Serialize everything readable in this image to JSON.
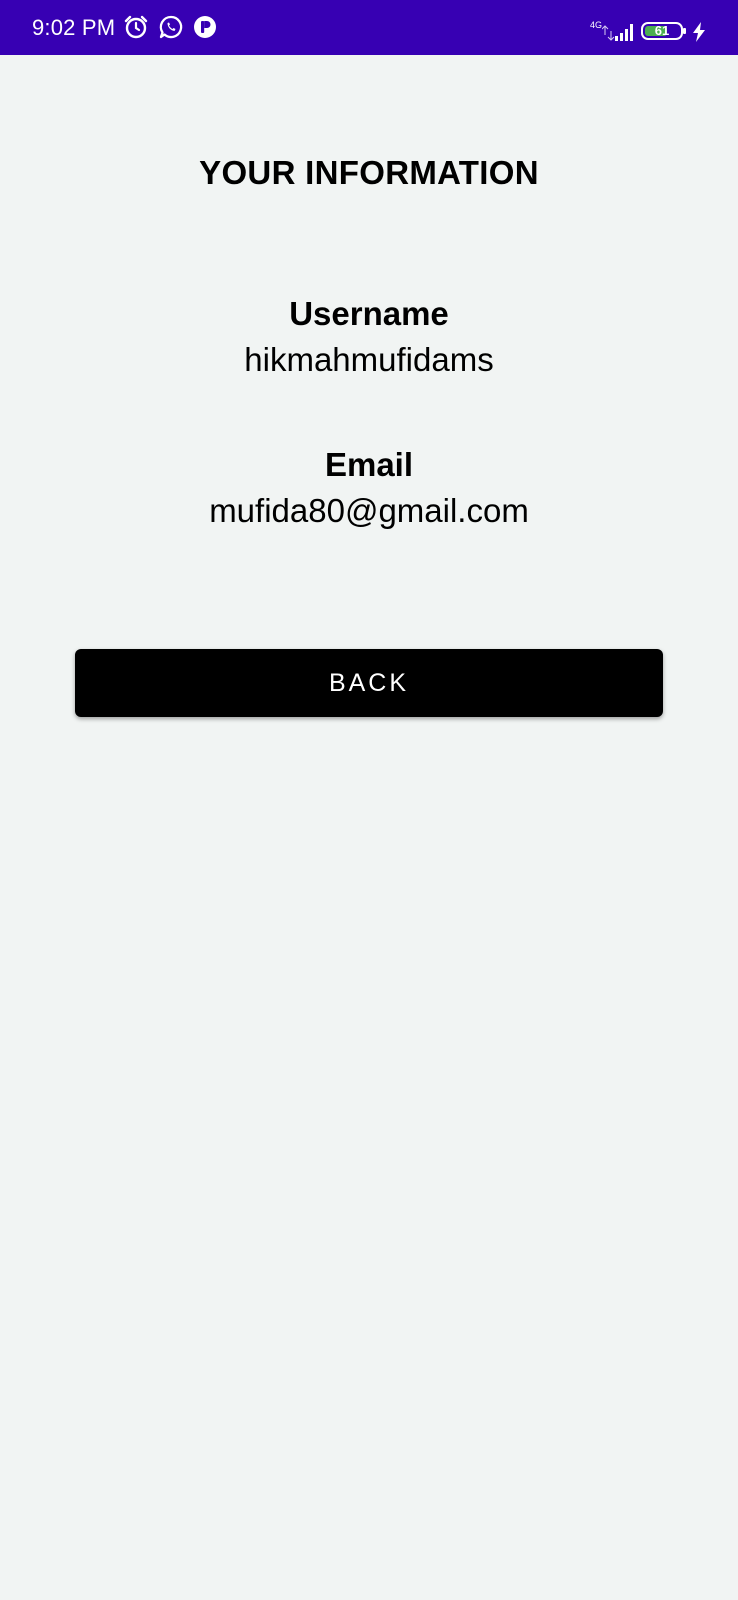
{
  "status_bar": {
    "time": "9:02 PM",
    "icons": [
      "alarm-icon",
      "whatsapp-icon",
      "app-notification-icon"
    ],
    "network_type": "4G",
    "battery_level": "61",
    "background_color": "#3700b3"
  },
  "screen": {
    "title": "YOUR INFORMATION",
    "fields": [
      {
        "label": "Username",
        "value": "hikmahmufidams"
      },
      {
        "label": "Email",
        "value": "mufida80@gmail.com"
      }
    ],
    "back_button_label": "BACK",
    "background_color": "#f1f4f3"
  }
}
